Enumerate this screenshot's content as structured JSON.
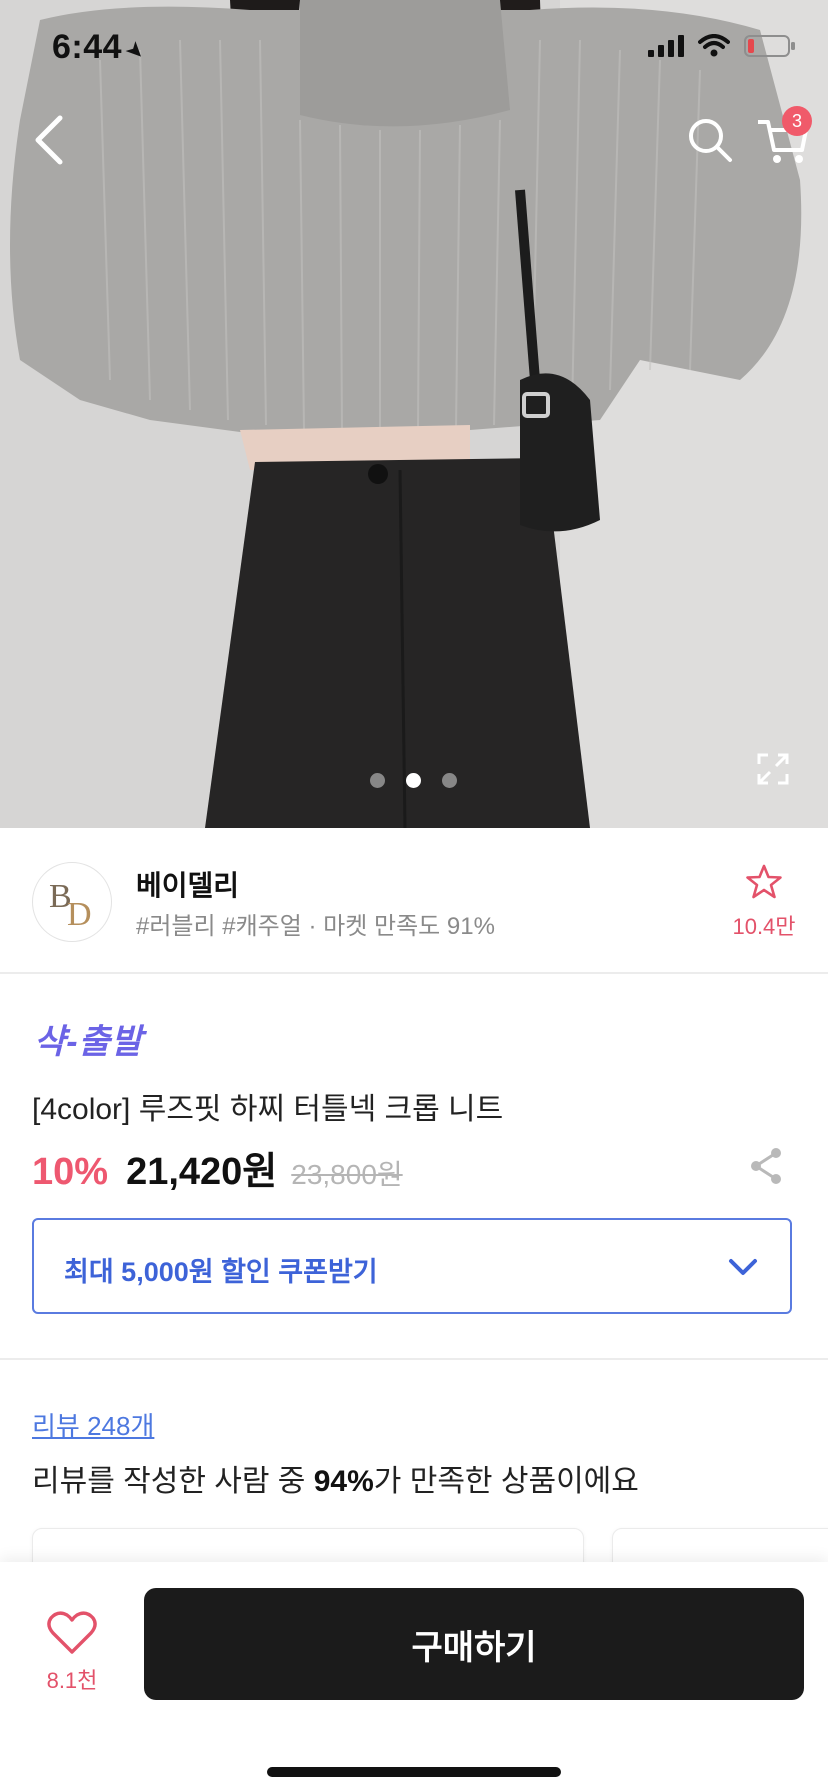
{
  "status_bar": {
    "time": "6:44"
  },
  "header": {
    "cart_count": "3"
  },
  "gallery": {
    "page_count": 3,
    "active_index": 1
  },
  "store": {
    "name": "베이델리",
    "tags": "#러블리 #캐주얼 · 마켓 만족도 91%",
    "favorite_count": "10.4만",
    "logo_text": "BD"
  },
  "product": {
    "shipping_badge": "샥-출발",
    "title": "[4color] 루즈핏 하찌 터틀넥 크롭 니트",
    "discount": "10%",
    "price": "21,420원",
    "original_price": "23,800원"
  },
  "coupon": {
    "label": "최대 5,000원 할인 쿠폰받기"
  },
  "reviews": {
    "link": "리뷰 248개",
    "summary_prefix": "리뷰를 작성한 사람 중 ",
    "summary_percent": "94%",
    "summary_suffix": "가 만족한 상품이에요"
  },
  "bottom_bar": {
    "like_count": "8.1천",
    "buy_label": "구매하기"
  },
  "colors": {
    "accent_pink": "#ee5870",
    "accent_blue": "#3d63d8",
    "badge_purple": "#6b63e6",
    "buy_button": "#1b1b1b"
  }
}
